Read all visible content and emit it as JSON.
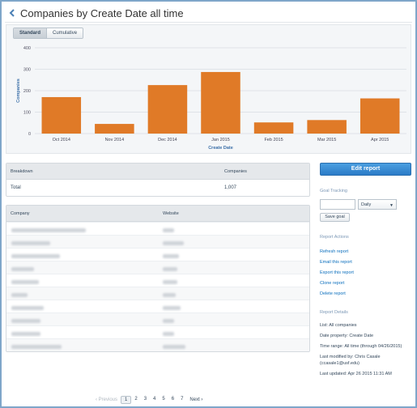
{
  "header": {
    "title": "Companies by Create Date all time"
  },
  "chart_toggle": {
    "standard": "Standard",
    "cumulative": "Cumulative"
  },
  "chart_data": {
    "type": "bar",
    "categories": [
      "Oct 2014",
      "Nov 2014",
      "Dec 2014",
      "Jan 2015",
      "Feb 2015",
      "Mar 2015",
      "Apr 2015"
    ],
    "values": [
      170,
      45,
      226,
      287,
      52,
      63,
      164
    ],
    "xlabel": "Create Date",
    "ylabel": "Companies",
    "ylim": [
      0,
      400
    ],
    "yticks": [
      "0",
      "100",
      "200",
      "300",
      "400"
    ],
    "grid": true,
    "bar_color": "#e07a27"
  },
  "breakdown": {
    "col_breakdown": "Breakdown",
    "col_companies": "Companies",
    "total_label": "Total",
    "total_value": "1,007"
  },
  "companies_table": {
    "col_company": "Company",
    "col_website": "Website",
    "row_count": 10
  },
  "pagination": {
    "previous": "Previous",
    "pages": [
      "1",
      "2",
      "3",
      "4",
      "5",
      "6",
      "7"
    ],
    "current": "1",
    "next": "Next"
  },
  "sidebar": {
    "edit_report": "Edit report",
    "goal_tracking": "Goal Tracking",
    "goal_period": "Daily",
    "save_goal": "Save goal",
    "report_actions": "Report Actions",
    "actions": [
      "Refresh report",
      "Email this report",
      "Export this report",
      "Clone report",
      "Delete report"
    ],
    "report_details": "Report Details",
    "details": [
      "List: All companies",
      "Date property: Create Date",
      "Time range: All time (through 04/26/2015)",
      "Last modified by: Chris Casale (ccasale1@usf.edu)",
      "Last updated: Apr 26 2015 11:31 AM"
    ]
  },
  "colors": {
    "accent": "#2b7bc7",
    "bar": "#e07a27",
    "link": "#0a6ebd"
  }
}
